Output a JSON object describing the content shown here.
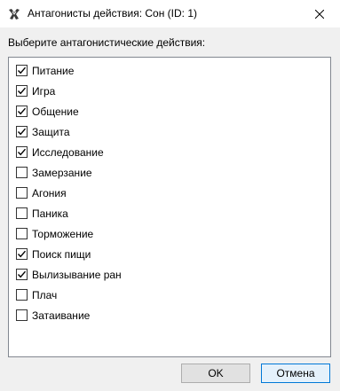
{
  "window": {
    "title": "Антагонисты действия: Сон (ID: 1)"
  },
  "prompt": "Выберите антагонистические действия:",
  "items": [
    {
      "label": "Питание",
      "checked": true
    },
    {
      "label": "Игра",
      "checked": true
    },
    {
      "label": "Общение",
      "checked": true
    },
    {
      "label": "Защита",
      "checked": true
    },
    {
      "label": "Исследование",
      "checked": true
    },
    {
      "label": "Замерзание",
      "checked": false
    },
    {
      "label": "Агония",
      "checked": false
    },
    {
      "label": "Паника",
      "checked": false
    },
    {
      "label": "Торможение",
      "checked": false
    },
    {
      "label": "Поиск пищи",
      "checked": true
    },
    {
      "label": "Вылизывание ран",
      "checked": true
    },
    {
      "label": "Плач",
      "checked": false
    },
    {
      "label": "Затаивание",
      "checked": false
    }
  ],
  "buttons": {
    "ok_label": "OK",
    "cancel_label": "Отмена"
  }
}
